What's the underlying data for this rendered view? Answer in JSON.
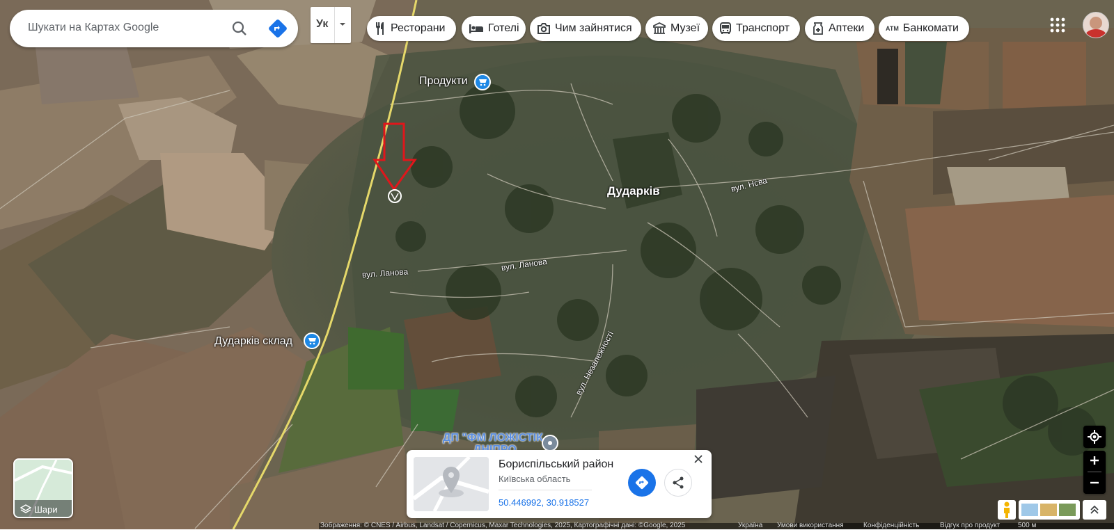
{
  "search": {
    "placeholder": "Шукати на Картах Google"
  },
  "language": {
    "code": "Ук"
  },
  "categories": [
    {
      "label": "Ресторани",
      "icon": "fork-knife-icon"
    },
    {
      "label": "Готелі",
      "icon": "bed-icon"
    },
    {
      "label": "Чим зайнятися",
      "icon": "camera-icon"
    },
    {
      "label": "Музеї",
      "icon": "museum-icon"
    },
    {
      "label": "Транспорт",
      "icon": "bus-icon"
    },
    {
      "label": "Аптеки",
      "icon": "pharmacy-icon"
    },
    {
      "label": "Банкомати",
      "icon": "atm-icon",
      "icon_text": "ATM"
    }
  ],
  "map": {
    "places": {
      "produkty": "Продукти",
      "dudarkiv": "Дударків",
      "sklad": "Дударків склад",
      "dp": "ДП \"ФМ ЛОЖІСТІК",
      "dp2": "ДНІПРО"
    },
    "streets": {
      "nsva": "вул. Нсва",
      "lanova1": "вул. Ланова",
      "lanova2": "вул. Ланова",
      "nezalezhnosti": "вул. Незалежності"
    }
  },
  "layers": {
    "label": "Шари"
  },
  "place_card": {
    "title": "Бориспільський район",
    "subtitle": "Київська область",
    "coords": "50.446992, 30.918527"
  },
  "footer": {
    "attribution": "Зображення: © CNES / Airbus, Landsat / Copernicus, Maxar Technologies, 2025, Картографічні дані: ©Google, 2025",
    "country": "Україна",
    "terms": "Умови використання",
    "privacy": "Конфіденційність",
    "feedback": "Відгук про продукт",
    "scale": "500 м"
  },
  "colors": {
    "accent": "#1a73e8",
    "marker_red": "#e0161b",
    "shop_blue": "#1e88e5"
  }
}
